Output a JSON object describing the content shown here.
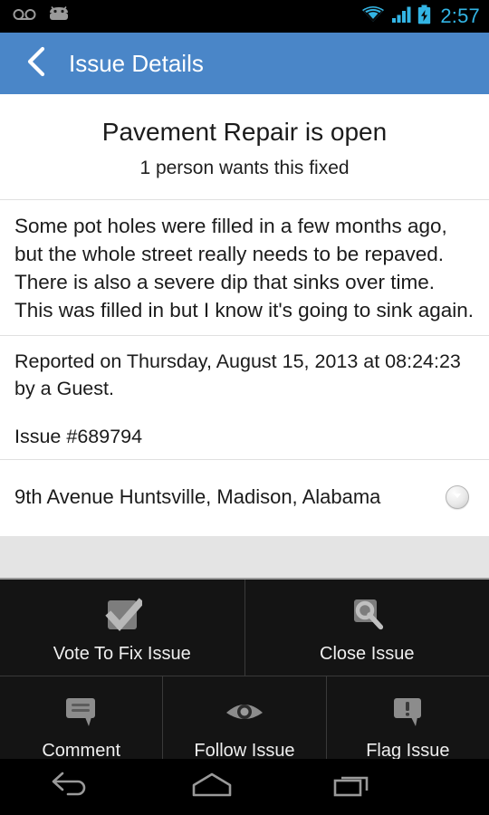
{
  "statusbar": {
    "time": "2:57",
    "icons": [
      "voicemail-icon",
      "android-icon",
      "wifi-icon",
      "cellular-signal-icon",
      "battery-charging-icon"
    ]
  },
  "actionbar": {
    "back_icon": "chevron-left-icon",
    "title": "Issue Details"
  },
  "hero": {
    "title": "Pavement Repair is open",
    "subtitle": "1 person wants this fixed"
  },
  "details": {
    "description": "Some pot holes were filled in a few months ago, but the whole street really needs to be repaved. There is also a severe dip that sinks over time. This was filled in but I know it's going to sink again.",
    "reported": "Reported on Thursday, August 15, 2013 at 08:24:23 by a Guest.",
    "issue_number": "Issue #689794",
    "address": "9th Avenue Huntsville, Madison, Alabama",
    "expand_icon": "chevron-down-circle-icon"
  },
  "actions": [
    [
      {
        "label": "Vote To Fix Issue",
        "icon": "checkbox-check-icon"
      },
      {
        "label": "Close Issue",
        "icon": "wrench-icon"
      }
    ],
    [
      {
        "label": "Comment",
        "icon": "speech-bubble-icon"
      },
      {
        "label": "Follow Issue",
        "icon": "eye-icon"
      },
      {
        "label": "Flag Issue",
        "icon": "alert-bubble-icon"
      }
    ]
  ],
  "navbar": {
    "back": "back-arrow-icon",
    "home": "home-icon",
    "recents": "recent-apps-icon",
    "overflow": "overflow-menu-icon"
  },
  "colors": {
    "accent": "#4a86c8",
    "status_accent": "#33b5e5",
    "panel": "#141414",
    "band": "#e4e4e4"
  }
}
